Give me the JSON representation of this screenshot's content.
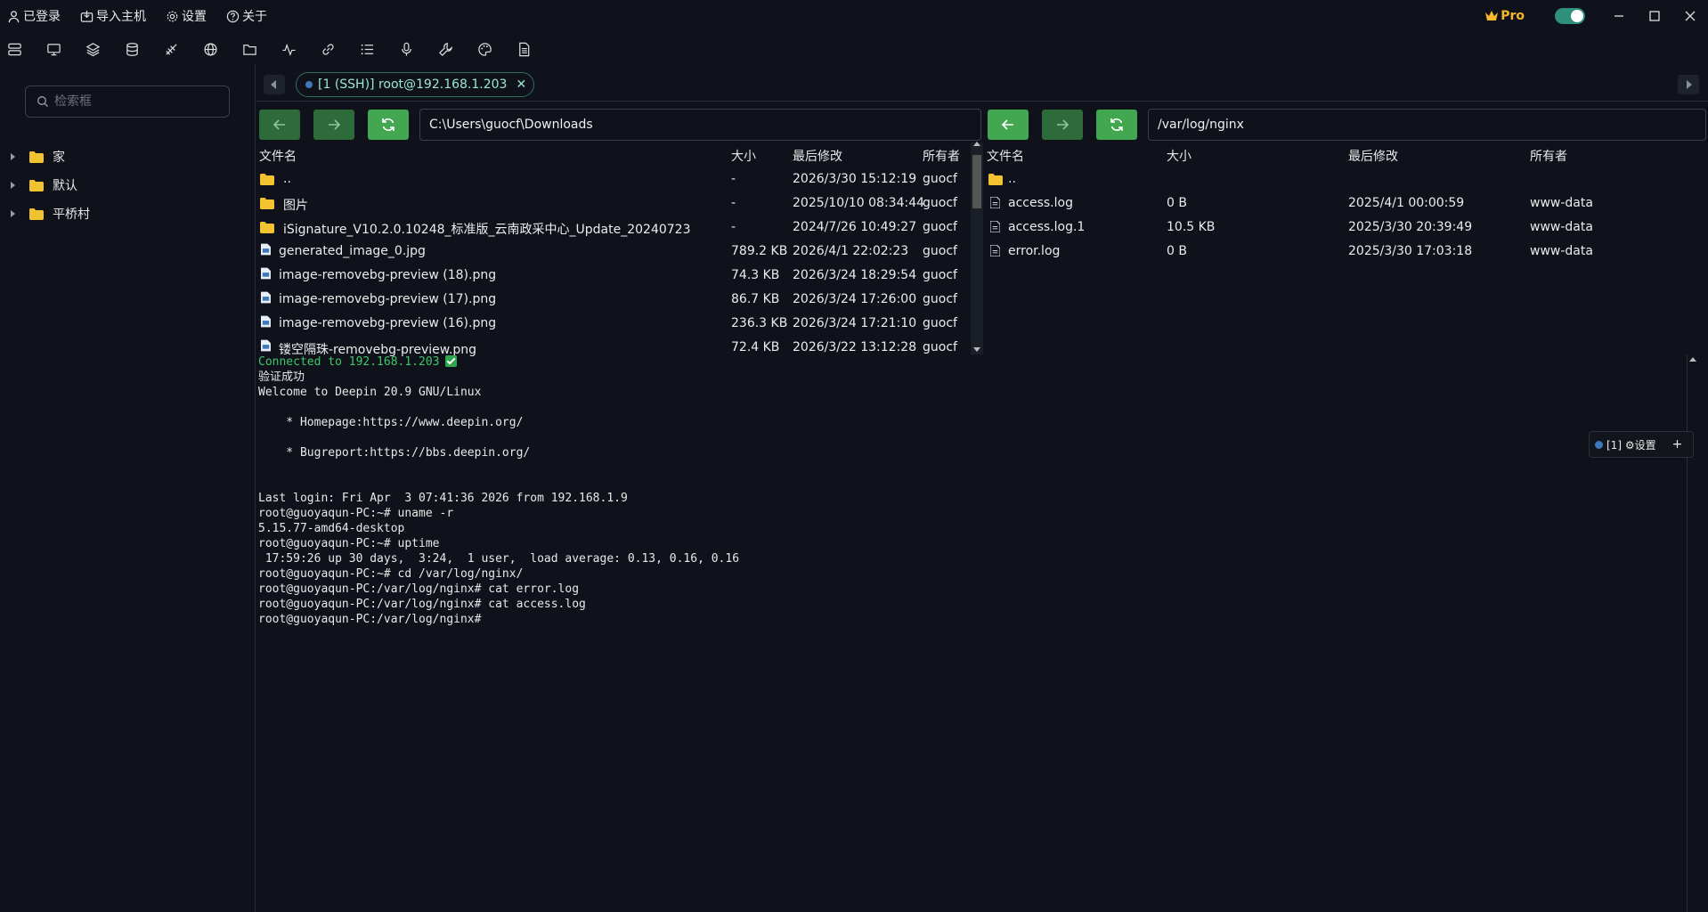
{
  "titlebar": {
    "menu": [
      {
        "label": "已登录",
        "icon": "user-icon"
      },
      {
        "label": "导入主机",
        "icon": "import-icon"
      },
      {
        "label": "设置",
        "icon": "gear-icon"
      },
      {
        "label": "关于",
        "icon": "help-icon"
      }
    ],
    "pro_label": "Pro",
    "toggle_on": true
  },
  "toolbar": {
    "icons": [
      "servers-icon",
      "monitor-icon",
      "layers-icon",
      "database-icon",
      "satellite-icon",
      "globe-icon",
      "folder-open-icon",
      "activity-icon",
      "link-icon",
      "list-icon",
      "microphone-icon",
      "wrench-icon",
      "palette-icon",
      "document-icon"
    ]
  },
  "sidebar": {
    "search_placeholder": "检索框",
    "groups": [
      {
        "label": "家"
      },
      {
        "label": "默认"
      },
      {
        "label": "平桥村"
      }
    ]
  },
  "tab": {
    "label": "[1 (SSH)] root@192.168.1.203"
  },
  "local_pane": {
    "path": "C:\\Users\\guocf\\Downloads",
    "columns": {
      "name": "文件名",
      "size": "大小",
      "modified": "最后修改",
      "owner": "所有者"
    },
    "files": [
      {
        "type": "folder",
        "name": "..",
        "size": "-",
        "modified": "2026/3/30 15:12:19",
        "owner": "guocf"
      },
      {
        "type": "folder",
        "name": "图片",
        "size": "-",
        "modified": "2025/10/10 08:34:44",
        "owner": "guocf"
      },
      {
        "type": "folder",
        "name": "iSignature_V10.2.0.10248_标准版_云南政采中心_Update_20240723",
        "size": "-",
        "modified": "2024/7/26 10:49:27",
        "owner": "guocf"
      },
      {
        "type": "image",
        "name": "generated_image_0.jpg",
        "size": "789.2 KB",
        "modified": "2026/4/1 22:02:23",
        "owner": "guocf"
      },
      {
        "type": "image",
        "name": "image-removebg-preview (18).png",
        "size": "74.3 KB",
        "modified": "2026/3/24 18:29:54",
        "owner": "guocf"
      },
      {
        "type": "image",
        "name": "image-removebg-preview (17).png",
        "size": "86.7 KB",
        "modified": "2026/3/24 17:26:00",
        "owner": "guocf"
      },
      {
        "type": "image",
        "name": "image-removebg-preview (16).png",
        "size": "236.3 KB",
        "modified": "2026/3/24 17:21:10",
        "owner": "guocf"
      },
      {
        "type": "image",
        "name": "镂空隔珠-removebg-preview.png",
        "size": "72.4 KB",
        "modified": "2026/3/22 13:12:28",
        "owner": "guocf"
      }
    ]
  },
  "remote_pane": {
    "path": "/var/log/nginx",
    "columns": {
      "name": "文件名",
      "size": "大小",
      "modified": "最后修改",
      "owner": "所有者"
    },
    "files": [
      {
        "type": "folder",
        "name": "..",
        "size": "",
        "modified": "",
        "owner": ""
      },
      {
        "type": "file",
        "name": "access.log",
        "size": "0 B",
        "modified": "2025/4/1 00:00:59",
        "owner": "www-data"
      },
      {
        "type": "file",
        "name": "access.log.1",
        "size": "10.5 KB",
        "modified": "2025/3/30 20:39:49",
        "owner": "www-data"
      },
      {
        "type": "file",
        "name": "error.log",
        "size": "0 B",
        "modified": "2025/3/30 17:03:18",
        "owner": "www-data"
      }
    ]
  },
  "terminal": {
    "connected": "Connected to 192.168.1.203",
    "lines": [
      "验证成功",
      "Welcome to Deepin 20.9 GNU/Linux",
      "",
      "    * Homepage:https://www.deepin.org/",
      "",
      "    * Bugreport:https://bbs.deepin.org/",
      "",
      "",
      "Last login: Fri Apr  3 07:41:36 2026 from 192.168.1.9",
      "root@guoyaqun-PC:~# uname -r",
      "5.15.77-amd64-desktop",
      "root@guoyaqun-PC:~# uptime",
      " 17:59:26 up 30 days,  3:24,  1 user,  load average: 0.13, 0.16, 0.16",
      "root@guoyaqun-PC:~# cd /var/log/nginx/",
      "root@guoyaqun-PC:/var/log/nginx# cat error.log",
      "root@guoyaqun-PC:/var/log/nginx# cat access.log",
      "root@guoyaqun-PC:/var/log/nginx#"
    ]
  },
  "session_chip": {
    "label": "[1] ⚙设置",
    "add": "+"
  },
  "colors": {
    "background": "#0f121a",
    "accent_green": "#43a651",
    "pro_gold": "#f5b82e",
    "terminal_green": "#3ec76a",
    "folder_yellow": "#f2c230"
  }
}
